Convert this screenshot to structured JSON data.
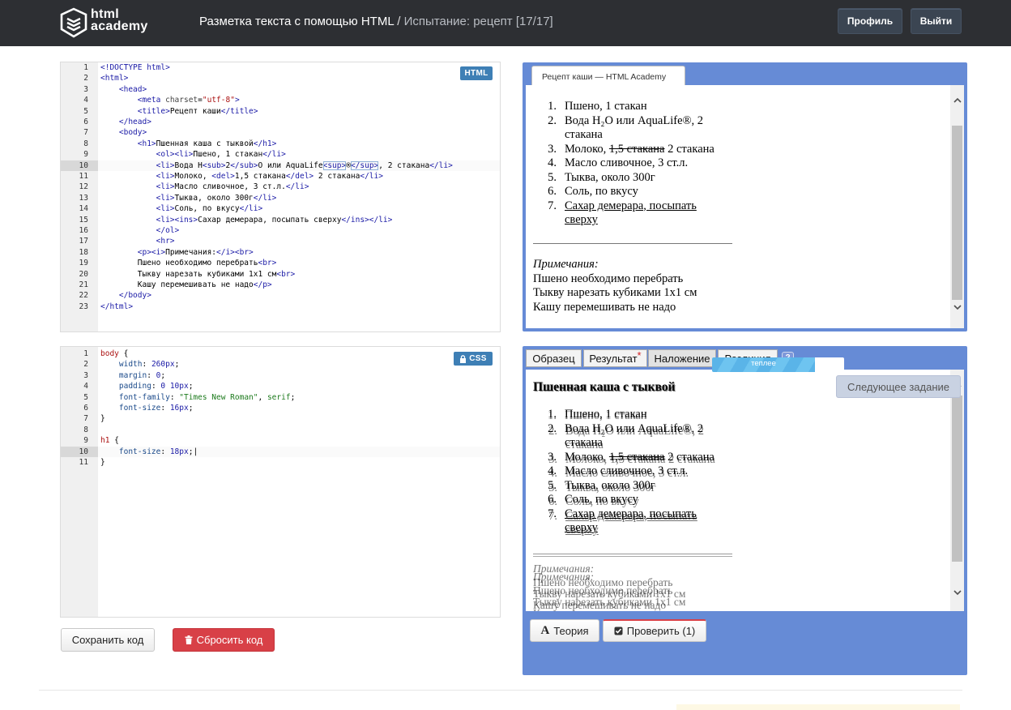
{
  "header": {
    "logo_line1": "html",
    "logo_line2": "academy",
    "course": "Разметка текста с помощью HTML",
    "separator": " / ",
    "task": "Испытание: рецепт",
    "progress": "[17/17]",
    "profile_label": "Профиль",
    "logout_label": "Выйти"
  },
  "html_editor": {
    "badge": "HTML",
    "active_line": 10,
    "lines": [
      "1",
      "2",
      "3",
      "4",
      "5",
      "6",
      "7",
      "8",
      "9",
      "10",
      "11",
      "12",
      "13",
      "14",
      "15",
      "16",
      "17",
      "18",
      "19",
      "20",
      "21",
      "22",
      "23"
    ]
  },
  "css_editor": {
    "badge": "CSS",
    "active_line": 10,
    "lines": [
      "1",
      "2",
      "3",
      "4",
      "5",
      "6",
      "7",
      "8",
      "9",
      "10",
      "11"
    ]
  },
  "buttons": {
    "save": "Сохранить код",
    "reset": "Сбросить код",
    "theory": "Теория",
    "check": "Проверить (1)",
    "next": "Следующее задание"
  },
  "preview": {
    "tab": "Рецепт каши — HTML Academy",
    "items": [
      {
        "n": "1.",
        "text": "Пшено, 1 стакан"
      },
      {
        "n": "2.",
        "text": "Вода H₂O или AquaLife®, 2"
      },
      {
        "n": "",
        "text": "стакана"
      },
      {
        "n": "3.",
        "pre": "Молоко, ",
        "del": "1,5 стакана",
        "post": " 2 стакана"
      },
      {
        "n": "4.",
        "text": "Масло сливочное, 3 ст.л."
      },
      {
        "n": "5.",
        "text": "Тыква, около 300г"
      },
      {
        "n": "6.",
        "text": "Соль, по вкусу"
      },
      {
        "n": "7.",
        "ins": "Сахар демерара, посыпать"
      },
      {
        "n": "",
        "ins": "сверху"
      }
    ],
    "notes_title": "Примечания:",
    "notes": [
      "Пшено необходимо перебрать",
      "Тыкву нарезать кубиками 1x1 см",
      "Кашу перемешивать не надо"
    ]
  },
  "compare": {
    "tabs": [
      "Образец",
      "Результат",
      "Наложение",
      "Различия"
    ],
    "selected_tab": "Наложение",
    "result_marker": "*",
    "help": "?",
    "heading": "Пшенная каша с тыквой"
  },
  "meter": {
    "label": "теплее",
    "fill_fraction": 0.78
  },
  "colors": {
    "panel": "#668bd6",
    "reset_button": "#d84047",
    "badge": "#3e7fb5"
  }
}
